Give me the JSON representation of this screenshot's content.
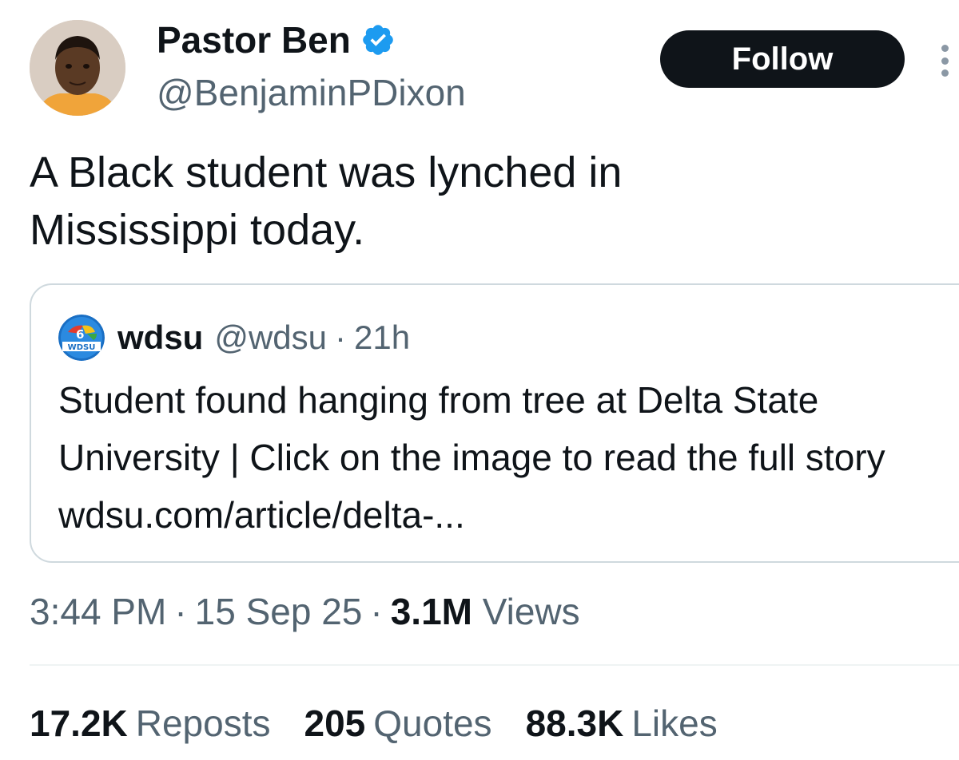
{
  "author": {
    "display_name": "Pastor Ben",
    "handle": "@BenjaminPDixon",
    "verified_icon": "verified-badge-icon",
    "avatar": "avatar-photo"
  },
  "follow_label": "Follow",
  "more_icon": "more-options-icon",
  "tweet_text": "A Black student was lynched in\nMississippi today.",
  "quote": {
    "name": "wdsu",
    "handle": "@wdsu",
    "separator": "·",
    "time": "21h",
    "logo_text": "WDSU",
    "text": "Student found hanging from tree at Delta State University  | Click on the image to read the full story wdsu.com/article/delta-..."
  },
  "meta": {
    "time": "3:44 PM",
    "date": "15 Sep 25",
    "separator": "·",
    "views_count": "3.1M",
    "views_label": "Views"
  },
  "stats": [
    {
      "value": "17.2K",
      "label": "Reposts"
    },
    {
      "value": "205",
      "label": "Quotes"
    },
    {
      "value": "88.3K",
      "label": "Likes"
    }
  ],
  "colors": {
    "text": "#0f1419",
    "secondary": "#536471",
    "verified": "#1d9bf0",
    "follow_bg": "#0f1419",
    "border": "#cfd9de"
  }
}
